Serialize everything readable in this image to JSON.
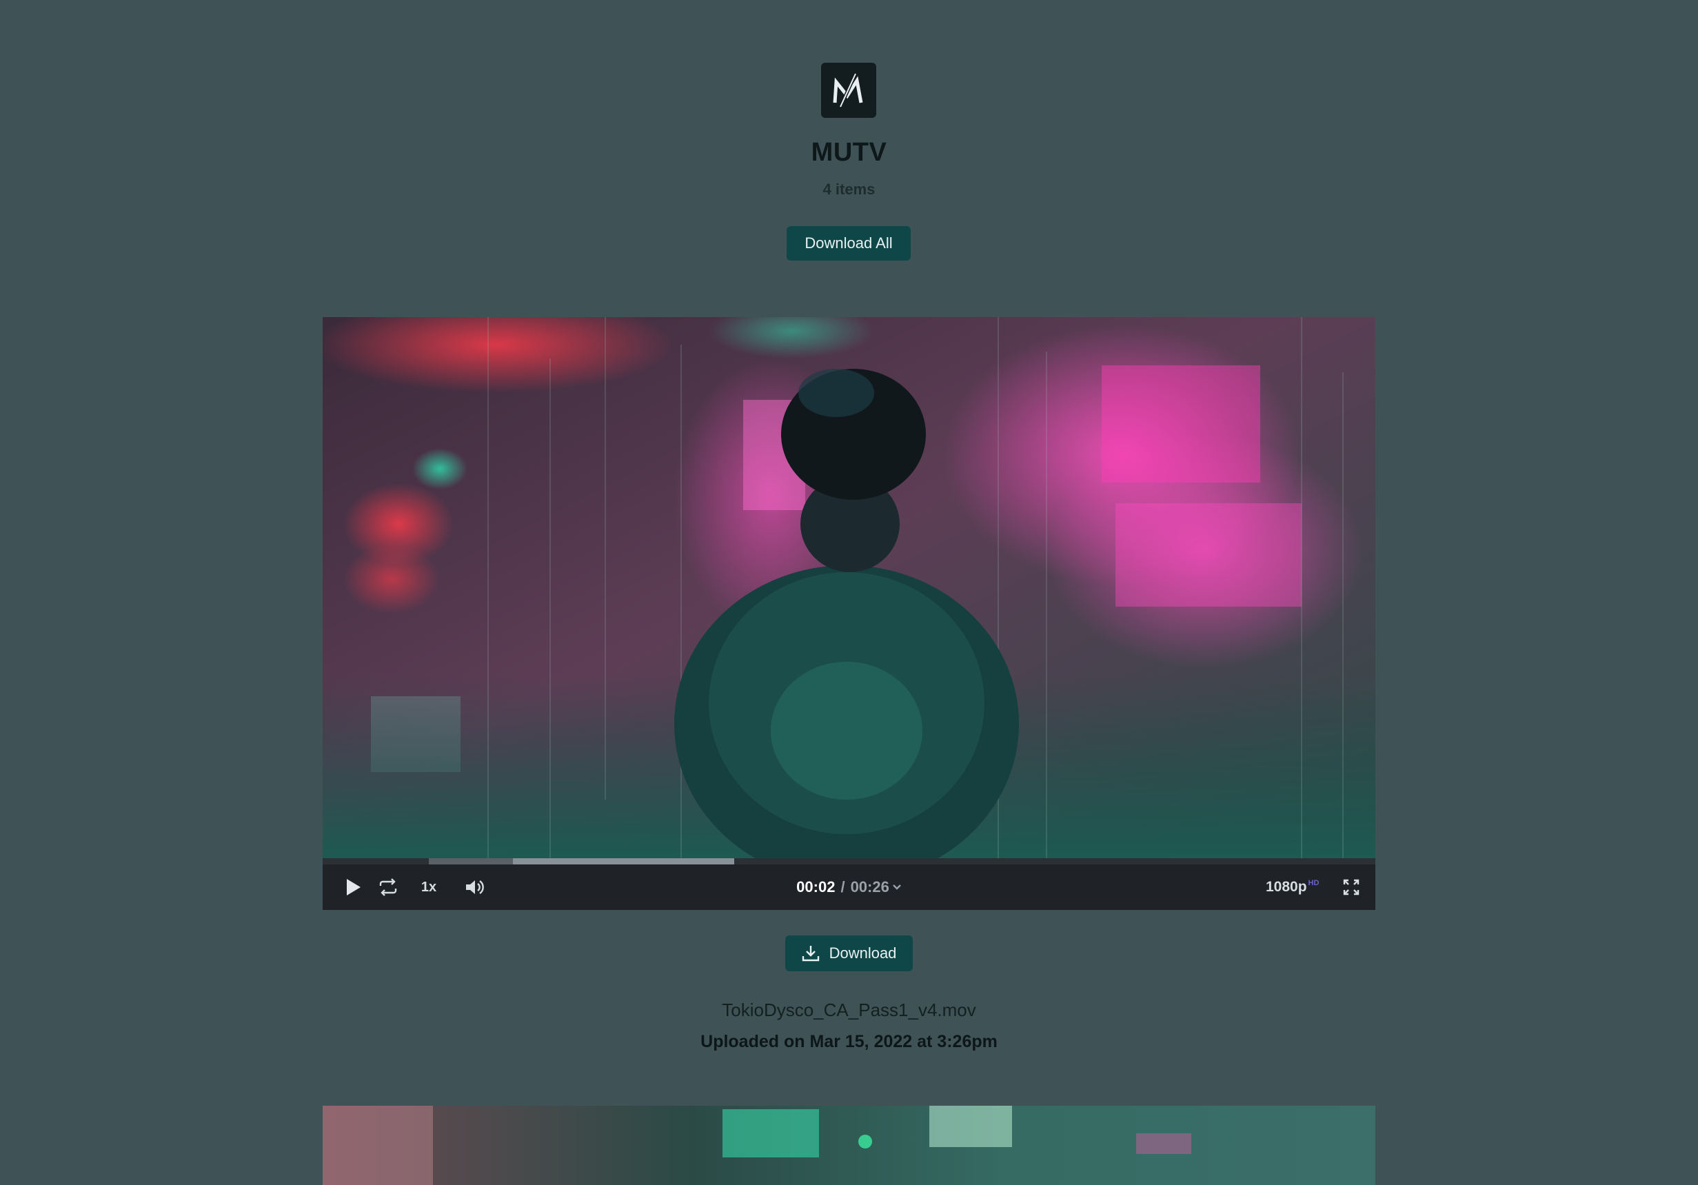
{
  "collection": {
    "title": "MUTV",
    "item_count": "4 items",
    "download_all_label": "Download All"
  },
  "player": {
    "current_time": "00:02",
    "separator": "/",
    "duration": "00:26",
    "speed": "1x",
    "quality": "1080p",
    "quality_badge": "HD",
    "progress_fraction": 0.08,
    "buffered_fraction": 0.29
  },
  "item": {
    "download_label": "Download",
    "filename": "TokioDysco_CA_Pass1_v4.mov",
    "uploaded": "Uploaded on Mar 15, 2022 at 3:26pm"
  },
  "icons": {
    "logo": "m-logo-icon",
    "play": "play-icon",
    "loop": "loop-icon",
    "volume": "volume-icon",
    "fullscreen": "fullscreen-icon",
    "download": "download-icon",
    "chevron": "chevron-down-icon"
  },
  "colors": {
    "background": "#3f5356",
    "button": "#0f4648",
    "controls_bar": "#1f2226",
    "hd_badge": "#6a63c8"
  }
}
